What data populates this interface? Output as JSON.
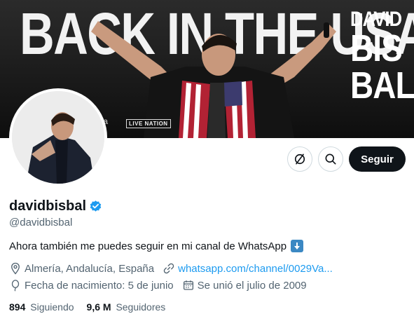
{
  "banner": {
    "headline": "BACK IN THE USA",
    "name_line1": "DAVID",
    "name_line2": "BIS",
    "name_line3": "BAL",
    "sponsor_logo": "LIVE NATION",
    "sponsor_logo2": "na"
  },
  "actions": {
    "more_icon": "more-options-icon",
    "search_icon": "search-icon",
    "follow_label": "Seguir"
  },
  "profile": {
    "display_name": "davidbisbal",
    "handle": "@davidbisbal",
    "bio": "Ahora también me puedes seguir en mi canal de WhatsApp",
    "bio_emoji": "down-arrow-emoji",
    "location": "Almería, Andalucía, España",
    "website": "whatsapp.com/channel/0029Va...",
    "birthday": "Fecha de nacimiento: 5 de junio",
    "joined": "Se unió el julio de 2009"
  },
  "stats": {
    "following_count": "894",
    "following_label": "Siguiendo",
    "followers_count": "9,6 M",
    "followers_label": "Seguidores"
  },
  "colors": {
    "accent": "#1d9bf0",
    "text": "#0f1419",
    "secondary": "#536471",
    "border": "#cfd9de"
  }
}
